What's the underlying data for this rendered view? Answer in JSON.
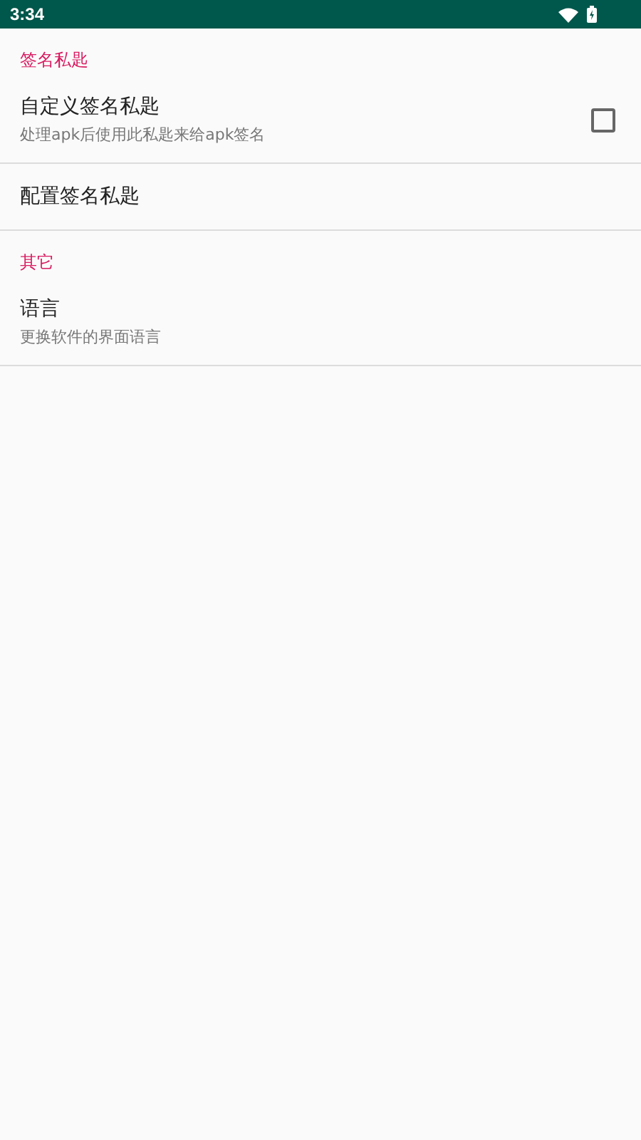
{
  "status_bar": {
    "time": "3:34"
  },
  "sections": [
    {
      "title": "签名私匙",
      "items": [
        {
          "kind": "checkbox",
          "title": "自定义签名私匙",
          "summary": "处理apk后使用此私匙来给apk签名",
          "checked": false
        },
        {
          "kind": "plain",
          "title": "配置签名私匙"
        }
      ]
    },
    {
      "title": "其它",
      "items": [
        {
          "kind": "plain",
          "title": "语言",
          "summary": "更换软件的界面语言"
        }
      ]
    }
  ]
}
